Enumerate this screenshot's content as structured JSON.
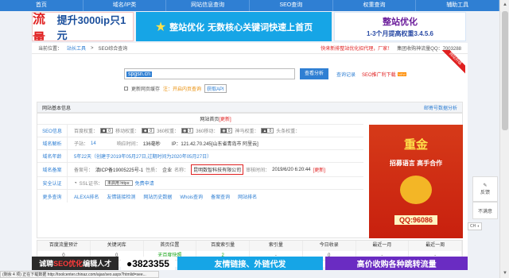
{
  "nav": [
    "首页",
    "域名/IP类",
    "网站信息查询",
    "SEO查询",
    "权重查询",
    "辅助工具"
  ],
  "banners": {
    "b1_big": "流量",
    "b1_rest": "提升3000ip只1元",
    "b2_title": "整站优化",
    "b2_text": "无数核心关键词快速上首页",
    "b3_title": "整站优化",
    "b3_sub": "1-3个月提高权重3.4.5.6"
  },
  "crumb": {
    "pos_label": "当前位置：",
    "l1": "站长工具",
    "sep": ">",
    "l2": "SEO综合查询",
    "notice": "快来新排整站优化招代理，厂家！",
    "notice2": "集团收购神流量QQ：7003288"
  },
  "search": {
    "value": "spgsn.cn",
    "button": "查看分析",
    "history": "查询记录",
    "plugin": "SEO推广利下载",
    "new": "NEW"
  },
  "opts": {
    "refresh": "更新网页缓存",
    "note": "注：开启内页查询",
    "btn": "获取API"
  },
  "box": {
    "title": "网站基本信息",
    "right": "邮寄号数据分析"
  },
  "rows": {
    "site_home": "网站首页",
    "site_update": "[更新]",
    "seo_label": "SEO信息",
    "seo_items": [
      {
        "name": "百度权重：",
        "val": "0"
      },
      {
        "name": "移动权重：",
        "val": "0"
      },
      {
        "name": "360权重：",
        "val": "0"
      },
      {
        "name": "360移动：",
        "val": "0"
      },
      {
        "name": "神马权重：",
        "val": "0"
      },
      {
        "name": "头条权重：",
        "val": "0"
      }
    ],
    "domain_label": "域名解析",
    "sub_count": "子站：",
    "sub_val": "14",
    "resp_label": "响应时间：",
    "resp_val": "136毫秒",
    "ip_label": "IP：121.42.70.245[山东省青岛市 阿里云]",
    "age_label": "域名年龄",
    "age_val": "5年22天（创建于2019年05月27日,过期时间为2020年05月27日）",
    "icp_label": "域名备案",
    "icp_no_label": "备案号：",
    "icp_no": "滇ICP备19005225号-1",
    "nature_label": "性质：",
    "nature": "企业",
    "name_label": "名称：",
    "name": "昆明数智科技有限公司",
    "check_label": "审核时间：",
    "check": "2019/6/20 6:20:44",
    "check_update": "[更新]",
    "sec_label": "安全认证",
    "ssl_label": "SSL证书：",
    "ssl_val": "未启用 https:",
    "ssl_btn": "免费申请",
    "more_label": "更多查询",
    "more_items": [
      "ALEXA排名",
      "友情链接检测",
      "网站历史数据",
      "Whois查询",
      "备案查询",
      "网站排名"
    ]
  },
  "ad": {
    "title": "重金",
    "sub": "招募语言 高手合作",
    "qq": "QQ:96086"
  },
  "stats": {
    "heads": [
      "百度流量预计",
      "关键词库",
      "首页位置",
      "百度索引量",
      "索引量",
      "今日收录",
      "最近一月",
      "最近一周"
    ],
    "vals": [
      "0",
      "0",
      "无百度快照",
      "2",
      "-",
      "0",
      "-",
      "-"
    ]
  },
  "bottom": {
    "b1a": "诚聘",
    "b1b": "SEO优化",
    "b1c": "编辑人才",
    "b2": "3823355",
    "b3": "友情链接、外链代发",
    "b4": "高价收购各种跳转流量"
  },
  "status": "(剩余 4 项) 正在下载数据 http://toolcenter.chinaz.com/ajax/seo.aspx?htmlid=see...",
  "side": {
    "r1": "反馈",
    "r2": "不满意",
    "ch": "CH"
  },
  "ribbon": "网站升级"
}
